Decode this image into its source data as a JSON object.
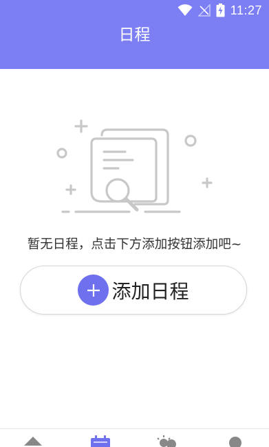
{
  "status_bar": {
    "time": "11:27",
    "icons": [
      "wifi-icon",
      "signal-off-icon",
      "battery-charging-icon"
    ]
  },
  "header": {
    "title": "日程"
  },
  "empty_state": {
    "illustration_icon": "document-search-icon",
    "message": "暂无日程，点击下方添加按钮添加吧~"
  },
  "add_button": {
    "icon": "plus-icon",
    "label": "添加日程"
  },
  "tab_bar": {
    "tabs": [
      {
        "icon": "home-icon",
        "active": false
      },
      {
        "icon": "calendar-icon",
        "active": true
      },
      {
        "icon": "weather-icon",
        "active": false
      },
      {
        "icon": "profile-icon",
        "active": false
      }
    ]
  },
  "colors": {
    "primary": "#7b7ff3",
    "button_accent": "#6e70ee",
    "illustration_gray": "#c8c8c8",
    "inactive_icon": "#888888"
  }
}
